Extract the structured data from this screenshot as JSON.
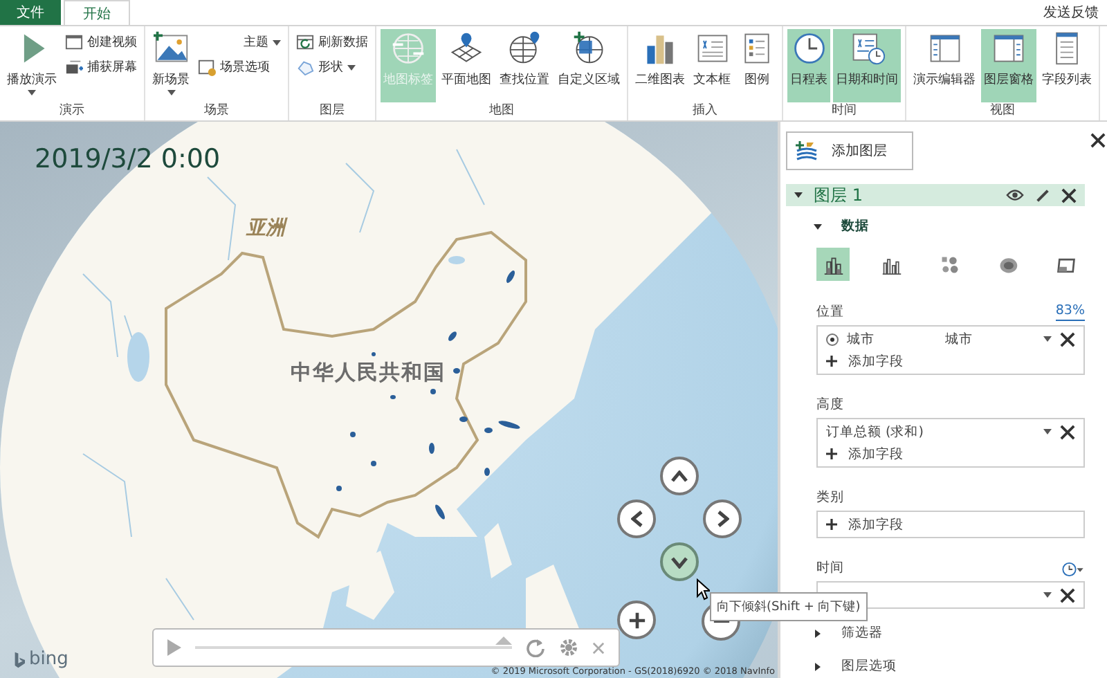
{
  "tabs": [
    {
      "label": "文件",
      "kind": "file",
      "selected": false
    },
    {
      "label": "开始",
      "kind": "tab",
      "selected": true
    }
  ],
  "feedback": "发送反馈",
  "ribbon_groups": [
    {
      "label": "演示",
      "items": [
        {
          "label": "播放演示",
          "kind": "large",
          "dropdown": true,
          "selected": false
        },
        {
          "label": "创建视频",
          "kind": "small",
          "dropdown": false,
          "selected": false
        },
        {
          "label": "捕获屏幕",
          "kind": "small",
          "dropdown": false,
          "selected": false
        }
      ]
    },
    {
      "label": "场景",
      "items": [
        {
          "label": "新场景",
          "kind": "large",
          "dropdown": true,
          "selected": false
        },
        {
          "label": "主题",
          "kind": "small",
          "dropdown": true,
          "selected": false
        },
        {
          "label": "场景选项",
          "kind": "small",
          "dropdown": false,
          "selected": false
        }
      ]
    },
    {
      "label": "图层",
      "items": [
        {
          "label": "刷新数据",
          "kind": "small",
          "dropdown": false,
          "selected": false
        },
        {
          "label": "形状",
          "kind": "small",
          "dropdown": true,
          "selected": false
        }
      ]
    },
    {
      "label": "地图",
      "items": [
        {
          "label": "地图标签",
          "kind": "large",
          "dropdown": false,
          "selected": true,
          "disabled": true
        },
        {
          "label": "平面地图",
          "kind": "large",
          "dropdown": false,
          "selected": false
        },
        {
          "label": "查找位置",
          "kind": "large",
          "dropdown": false,
          "selected": false
        },
        {
          "label": "自定义区域",
          "kind": "large",
          "dropdown": false,
          "selected": false
        }
      ]
    },
    {
      "label": "插入",
      "items": [
        {
          "label": "二维图表",
          "kind": "large",
          "dropdown": false,
          "selected": false
        },
        {
          "label": "文本框",
          "kind": "large",
          "dropdown": false,
          "selected": false
        },
        {
          "label": "图例",
          "kind": "large",
          "dropdown": false,
          "selected": false
        }
      ]
    },
    {
      "label": "时间",
      "items": [
        {
          "label": "日程表",
          "kind": "large",
          "dropdown": false,
          "selected": true
        },
        {
          "label": "日期和时间",
          "kind": "large",
          "dropdown": false,
          "selected": true
        }
      ]
    },
    {
      "label": "视图",
      "items": [
        {
          "label": "演示编辑器",
          "kind": "large",
          "dropdown": false,
          "selected": false
        },
        {
          "label": "图层窗格",
          "kind": "large",
          "dropdown": false,
          "selected": true
        },
        {
          "label": "字段列表",
          "kind": "large",
          "dropdown": false,
          "selected": false
        }
      ]
    }
  ],
  "map": {
    "time": "2019/3/2 0:00",
    "labels": [
      {
        "text": "亚洲",
        "kind": "continent"
      },
      {
        "text": "中华人民共和国",
        "kind": "country"
      }
    ],
    "logo": "bing",
    "copyright": "© 2019 Microsoft Corporation - GS(2018)6920  © 2018 NavInfo",
    "nav": [
      {
        "hover": false
      },
      {
        "hover": false
      },
      {
        "hover": false
      },
      {
        "hover": true
      },
      {
        "hover": false
      },
      {
        "hover": false
      }
    ],
    "player": {
      "level": 1
    },
    "tooltip": "向下倾斜(Shift + 向下键)"
  },
  "panel": {
    "add_layer": "添加图层",
    "layer": {
      "name": "图层 1",
      "expanded": true
    },
    "data_section": {
      "title": "数据",
      "expanded": true
    },
    "viz_types": [
      {
        "selected": true
      },
      {
        "selected": false
      },
      {
        "selected": false
      },
      {
        "selected": false
      },
      {
        "selected": false
      }
    ],
    "wells": [
      {
        "label": "位置",
        "link": "83%",
        "clock": false,
        "fields": [
          {
            "kind": "radio",
            "name": "城市",
            "selected": true,
            "value": "城市"
          }
        ],
        "add": "添加字段"
      },
      {
        "label": "高度",
        "clock": false,
        "fields": [
          {
            "kind": "plain",
            "name": "订单总额 (求和)"
          }
        ],
        "add": "添加字段"
      },
      {
        "label": "类别",
        "clock": false,
        "add": "添加字段"
      },
      {
        "label": "时间",
        "clock": true,
        "fields": [
          {
            "kind": "covered"
          }
        ]
      }
    ],
    "sections": [
      {
        "title": "筛选器",
        "expanded": false
      },
      {
        "title": "图层选项",
        "expanded": false
      }
    ]
  }
}
